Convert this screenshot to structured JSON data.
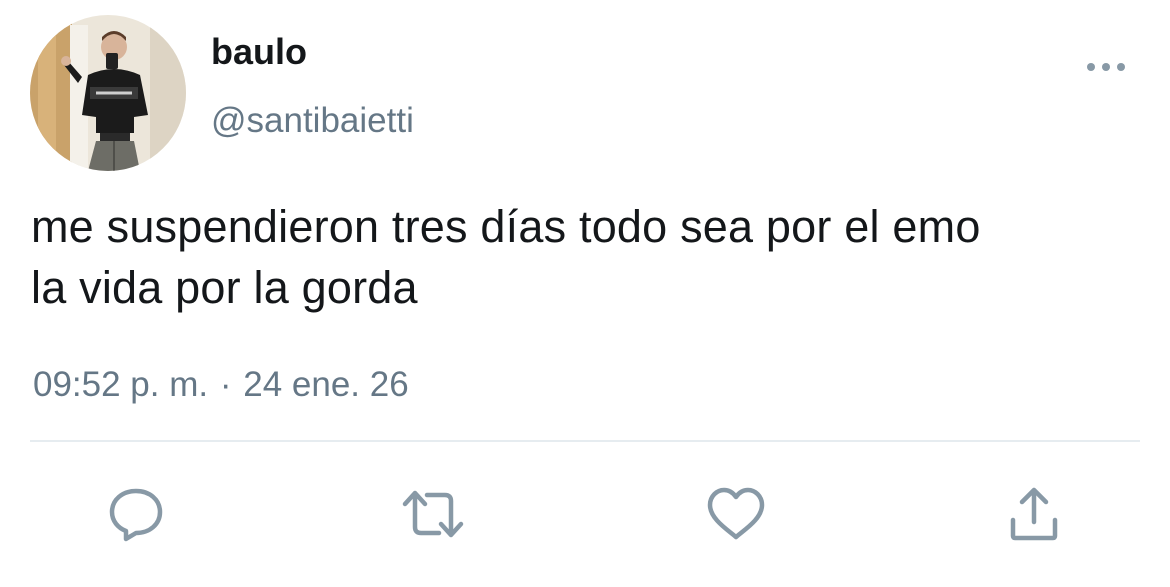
{
  "author": {
    "display_name": "baulo",
    "handle": "@santibaietti",
    "avatar_description": "avatar"
  },
  "tweet": {
    "text": "me suspendieron tres días todo sea por el emo\nla vida por la gorda",
    "time": "09:52 p. m.",
    "separator": "·",
    "date": "24 ene. 26"
  },
  "actions": {
    "reply_icon": "reply-icon",
    "retweet_icon": "retweet-icon",
    "like_icon": "heart-icon",
    "share_icon": "share-icon",
    "more_icon": "more-icon"
  },
  "colors": {
    "text": "#14171a",
    "secondary": "#657786",
    "divider": "#e6ecf0",
    "icon": "#8899a6"
  }
}
